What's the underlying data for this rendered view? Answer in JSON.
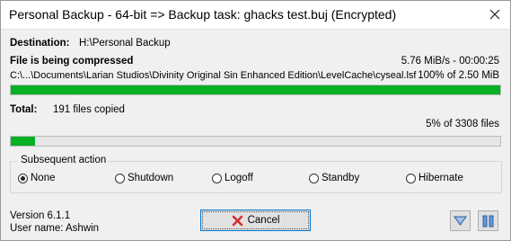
{
  "window": {
    "title": "Personal Backup - 64-bit => Backup task: ghacks test.buj (Encrypted)",
    "close_icon": "close-icon"
  },
  "destination": {
    "label": "Destination:",
    "value": "H:\\Personal Backup"
  },
  "file_status": {
    "heading": "File is being compressed",
    "speed": "5.76 MiB/s - 00:00:25",
    "path": "C:\\...\\Documents\\Larian Studios\\Divinity Original Sin Enhanced Edition\\LevelCache\\cyseal.lsf",
    "progress_text": "100% of 2.50 MiB",
    "progress_percent": 100
  },
  "total": {
    "label": "Total:",
    "value": "191 files copied",
    "progress_text": "5% of 3308 files",
    "progress_percent": 5
  },
  "subsequent_action": {
    "legend": "Subsequent action",
    "options": [
      {
        "label": "None",
        "selected": true
      },
      {
        "label": "Shutdown",
        "selected": false
      },
      {
        "label": "Logoff",
        "selected": false
      },
      {
        "label": "Standby",
        "selected": false
      },
      {
        "label": "Hibernate",
        "selected": false
      }
    ]
  },
  "footer": {
    "version": "Version 6.1.1",
    "user": "User name: Ashwin",
    "cancel_label": "Cancel",
    "cancel_icon": "red-x-icon",
    "minimize_icon": "triangle-down-icon",
    "pause_icon": "pause-icon"
  },
  "colors": {
    "progress": "#06b025",
    "cancel_x": "#d32f2f",
    "accent_border": "#0078d7",
    "icon_blue": "#2c5aa0"
  }
}
